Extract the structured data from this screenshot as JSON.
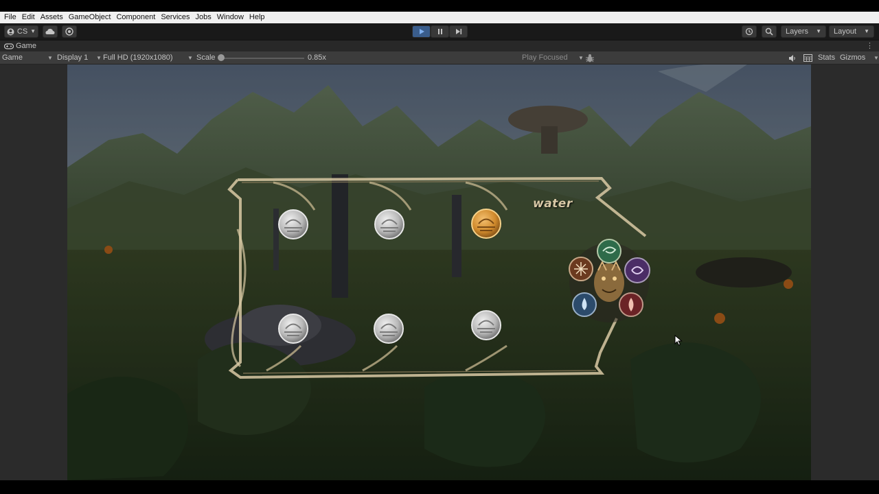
{
  "menu": [
    "File",
    "Edit",
    "Assets",
    "GameObject",
    "Component",
    "Services",
    "Jobs",
    "Window",
    "Help"
  ],
  "toolbar": {
    "account_label": "CS",
    "right_dropdowns": [
      "Layers",
      "Layout"
    ]
  },
  "tab": {
    "label": "Game"
  },
  "gamebar": {
    "view_mode": "Game",
    "display": "Display 1",
    "resolution": "Full HD (1920x1080)",
    "scale_label": "Scale",
    "scale_value": "0.85x",
    "play_mode": "Play Focused",
    "stats": "Stats",
    "gizmos": "Gizmos"
  },
  "game": {
    "selected_element": "water",
    "element_wheel": [
      "wind",
      "void",
      "fire",
      "water",
      "light"
    ],
    "slots": [
      {
        "state": "inactive"
      },
      {
        "state": "inactive"
      },
      {
        "state": "active"
      },
      {
        "state": "inactive"
      },
      {
        "state": "inactive"
      },
      {
        "state": "inactive"
      }
    ],
    "colors": {
      "active_slot": "#d08a2c",
      "inactive_slot": "#b9b9b9",
      "frame": "#d9c9a4",
      "wind": "#2e6b4a",
      "void": "#4b2d66",
      "fire": "#6b2326",
      "water": "#2c4b6b",
      "light": "#6b3a1f"
    }
  }
}
